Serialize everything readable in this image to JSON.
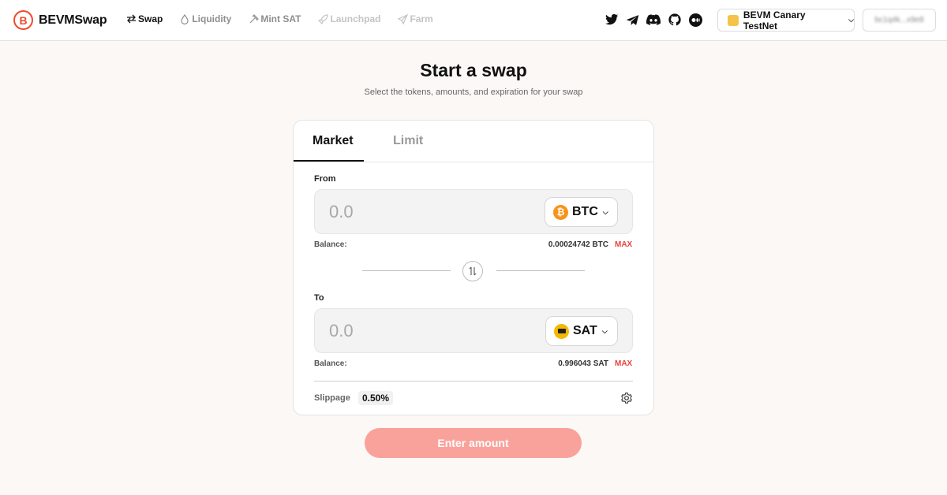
{
  "header": {
    "logo_text": "BEVMSwap",
    "logo_letter": "B",
    "nav": [
      {
        "label": "Swap",
        "icon": "swap-arrows-icon",
        "state": "active"
      },
      {
        "label": "Liquidity",
        "icon": "droplet-icon",
        "state": "normal"
      },
      {
        "label": "Mint SAT",
        "icon": "hammer-icon",
        "state": "normal"
      },
      {
        "label": "Launchpad",
        "icon": "rocket-icon",
        "state": "disabled"
      },
      {
        "label": "Farm",
        "icon": "plane-icon",
        "state": "disabled"
      }
    ],
    "socials": [
      "twitter-icon",
      "telegram-icon",
      "discord-icon",
      "github-icon",
      "medium-icon"
    ],
    "network": "BEVM Canary TestNet",
    "wallet_address": "bc1q4k...x9e8"
  },
  "page": {
    "title": "Start a swap",
    "subtitle": "Select the tokens, amounts, and expiration for your swap"
  },
  "tabs": {
    "market": "Market",
    "limit": "Limit",
    "active": "Market"
  },
  "from": {
    "label": "From",
    "placeholder": "0.0",
    "token": "BTC",
    "balance_label": "Balance:",
    "balance": "0.00024742 BTC",
    "max": "MAX"
  },
  "to": {
    "label": "To",
    "placeholder": "0.0",
    "token": "SAT",
    "balance_label": "Balance:",
    "balance": "0.996043 SAT",
    "max": "MAX"
  },
  "slippage": {
    "label": "Slippage",
    "value": "0.50%"
  },
  "cta": "Enter amount",
  "colors": {
    "accent": "#ef4b2c",
    "max": "#e8453c",
    "cta": "#f9a29b",
    "btc": "#f7931a",
    "sat": "#f5b800"
  }
}
